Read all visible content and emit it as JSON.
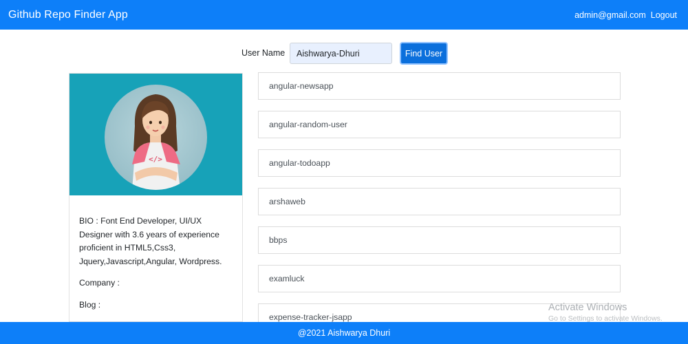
{
  "app": {
    "title": "Github Repo Finder App",
    "accent_color": "#0d7ff9"
  },
  "nav": {
    "user_email": "admin@gmail.com",
    "logout_label": "Logout"
  },
  "search": {
    "label": "User Name",
    "value": "Aishwarya-Dhuri",
    "button_label": "Find User"
  },
  "profile": {
    "banner_color": "#17a2b8",
    "avatar_icon": "developer-girl-avatar",
    "bio": "BIO : Font End Developer, UI/UX Designer with 3.6 years of experience proficient in HTML5,Css3, Jquery,Javascript,Angular, Wordpress.",
    "company": "Company :",
    "blog": "Blog :"
  },
  "repos": [
    "angular-newsapp",
    "angular-random-user",
    "angular-todoapp",
    "arshaweb",
    "bbps",
    "examluck",
    "expense-tracker-jsapp"
  ],
  "watermark": {
    "title": "Activate Windows",
    "subtitle": "Go to Settings to activate Windows."
  },
  "footer": {
    "text": "@2021 Aishwarya Dhuri"
  }
}
